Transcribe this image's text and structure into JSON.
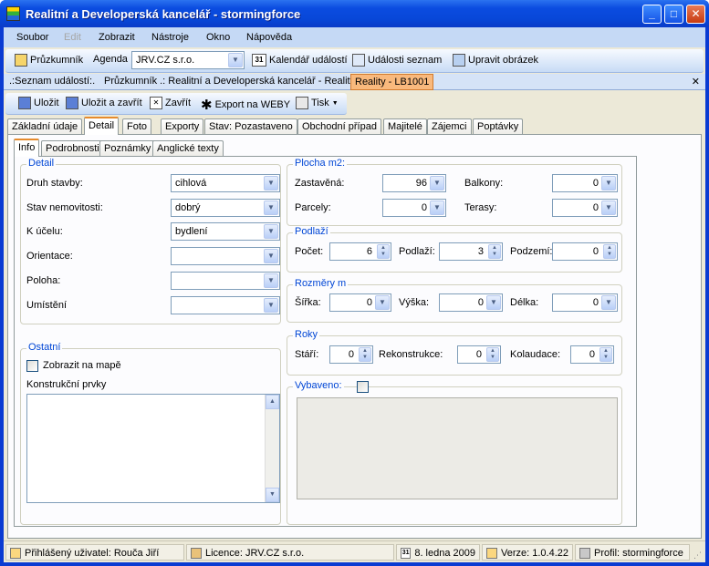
{
  "window": {
    "title": "Realitní a Developerská kancelář - stormingforce"
  },
  "menu": [
    {
      "label": "Soubor",
      "enabled": true
    },
    {
      "label": "Edit",
      "enabled": false
    },
    {
      "label": "Zobrazit",
      "enabled": true
    },
    {
      "label": "Nástroje",
      "enabled": true
    },
    {
      "label": "Okno",
      "enabled": true
    },
    {
      "label": "Nápověda",
      "enabled": true
    }
  ],
  "toolbar1": {
    "explorer": "Průzkumník",
    "agenda_label": "Agenda",
    "agenda_value": "JRV.CZ s.r.o.",
    "calendar": "Kalendář událostí",
    "events_list": "Události seznam",
    "edit_image": "Upravit obrázek",
    "calendar_icon_text": "31"
  },
  "doc_tabs": [
    {
      "label": ".:Seznam událostí:."
    },
    {
      "label": "Průzkumník .: Realitní a Developerská kancelář - Reality"
    },
    {
      "label": "Reality - LB1001",
      "active": true
    }
  ],
  "toolbar2": {
    "save": "Uložit",
    "save_close": "Uložit a zavřít",
    "close": "Zavřít",
    "export": "Export na WEBY",
    "print": "Tisk"
  },
  "main_tabs": [
    {
      "label": "Základní údaje"
    },
    {
      "label": "Detail",
      "active": true
    },
    {
      "label": "Foto"
    },
    {
      "label": "Exporty"
    },
    {
      "label": "Stav: Pozastaveno"
    },
    {
      "label": "Obchodní případ"
    },
    {
      "label": "Majitelé"
    },
    {
      "label": "Zájemci"
    },
    {
      "label": "Poptávky"
    }
  ],
  "sub_tabs": [
    {
      "label": "Info",
      "active": true
    },
    {
      "label": "Podrobnosti"
    },
    {
      "label": "Poznámky"
    },
    {
      "label": "Anglické texty"
    }
  ],
  "detail": {
    "title": "Detail",
    "fields": [
      {
        "label": "Druh stavby:",
        "value": "cihlová"
      },
      {
        "label": "Stav nemovitosti:",
        "value": "dobrý"
      },
      {
        "label": "K účelu:",
        "value": "bydlení"
      },
      {
        "label": "Orientace:",
        "value": ""
      },
      {
        "label": "Poloha:",
        "value": ""
      },
      {
        "label": "Umístění",
        "value": ""
      }
    ]
  },
  "ostatni": {
    "title": "Ostatní",
    "show_on_map": "Zobrazit na mapě",
    "show_on_map_checked": false,
    "construction": "Konstrukční prvky",
    "construction_text": ""
  },
  "plocha": {
    "title": "Plocha m2:",
    "zastavena_label": "Zastavěná:",
    "zastavena": "96",
    "balkony_label": "Balkony:",
    "balkony": "0",
    "parcely_label": "Parcely:",
    "parcely": "0",
    "terasy_label": "Terasy:",
    "terasy": "0"
  },
  "podlazi": {
    "title": "Podlaží",
    "pocet_label": "Počet:",
    "pocet": "6",
    "podlazi_label": "Podlaží:",
    "podlazi": "3",
    "podzemi_label": "Podzemí:",
    "podzemi": "0"
  },
  "rozmery": {
    "title": "Rozměry m",
    "sirka_label": "Šířka:",
    "sirka": "0",
    "vyska_label": "Výška:",
    "vyska": "0",
    "delka_label": "Délka:",
    "delka": "0"
  },
  "roky": {
    "title": "Roky",
    "stari_label": "Stáří:",
    "stari": "0",
    "rekonstrukce_label": "Rekonstrukce:",
    "rekonstrukce": "0",
    "kolaudace_label": "Kolaudace:",
    "kolaudace": "0"
  },
  "vybaveno": {
    "title": "Vybaveno:",
    "checked": false
  },
  "status": {
    "user": "Přihlášený uživatel: Rouča Jiří",
    "license": "Licence: JRV.CZ s.r.o.",
    "date": "8. ledna 2009",
    "date_icon_text": "31",
    "version": "Verze: 1.0.4.22",
    "profile": "Profil: stormingforce"
  }
}
